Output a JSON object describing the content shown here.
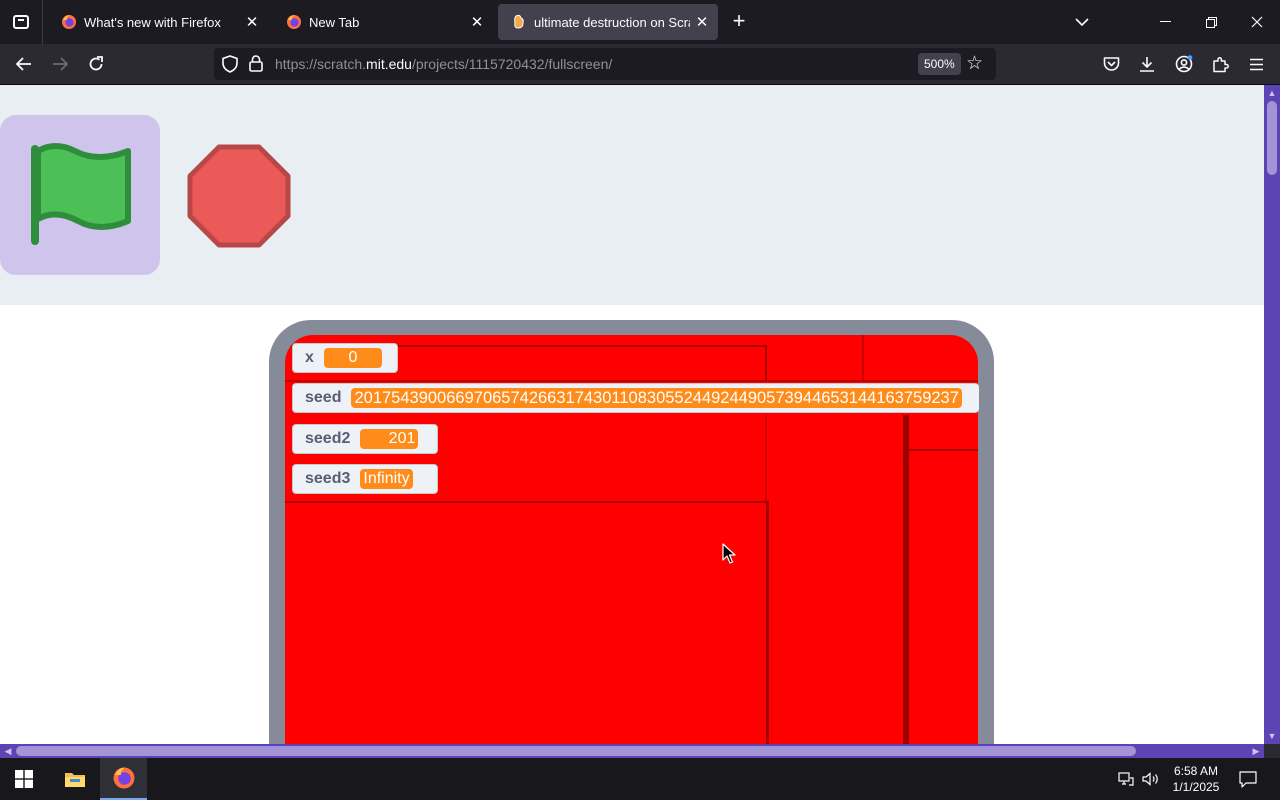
{
  "browser": {
    "tabs": [
      {
        "label": "What's new with Firefox",
        "active": false
      },
      {
        "label": "New Tab",
        "active": false
      },
      {
        "label": "ultimate destruction on Scratch",
        "active": true
      }
    ],
    "url_prefix": "https://scratch.",
    "url_domain": "mit.edu",
    "url_path": "/projects/1115720432/fullscreen/",
    "zoom": "500%"
  },
  "project": {
    "monitors": [
      {
        "name": "x",
        "value": "0"
      },
      {
        "name": "seed",
        "value": "201754390066970657426631743011083055244924490573944653144163759237"
      },
      {
        "name": "seed2",
        "value": "201"
      },
      {
        "name": "seed3",
        "value": "Infinity"
      }
    ]
  },
  "taskbar": {
    "time": "6:58 AM",
    "date": "1/1/2025"
  },
  "colors": {
    "stage": "#ff0000",
    "flag_button_bg": "#cfc4ec",
    "monitor_value": "#ff8c1a",
    "scrollbar": "#5d44b5"
  }
}
